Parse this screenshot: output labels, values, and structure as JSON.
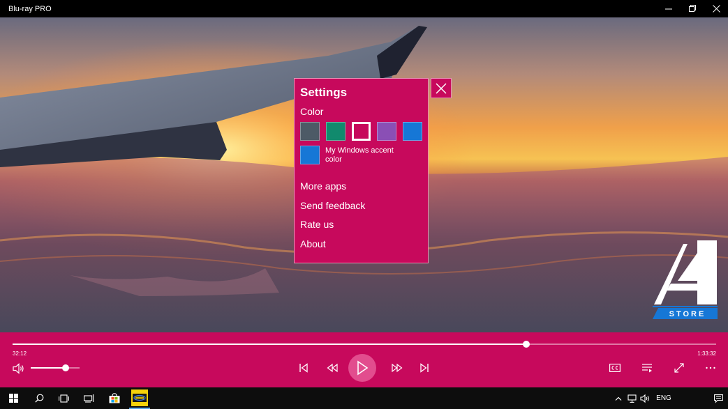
{
  "window": {
    "title": "Blu-ray PRO",
    "controls": [
      "minimize-icon",
      "restore-icon",
      "close-icon"
    ]
  },
  "settings": {
    "title": "Settings",
    "color_label": "Color",
    "swatches": [
      {
        "color": "#4d5a66",
        "selected": false
      },
      {
        "color": "#118a6d",
        "selected": false
      },
      {
        "color": "#c7095c",
        "selected": true
      },
      {
        "color": "#8a4fb5",
        "selected": false
      },
      {
        "color": "#1677d6",
        "selected": false
      }
    ],
    "accent_swatch_color": "#1677d6",
    "accent_label": "My Windows accent color",
    "menu": [
      "More apps",
      "Send feedback",
      "Rate us",
      "About"
    ]
  },
  "store_logo_text": "STORE",
  "player": {
    "elapsed": "32:12",
    "total": "1:33:32",
    "progress": 0.73,
    "volume": 0.72
  },
  "taskbar": {
    "language": "ENG"
  },
  "colors": {
    "accent": "#c7095c",
    "titlebar": "#000000",
    "taskbar": "#0d0d0d"
  }
}
